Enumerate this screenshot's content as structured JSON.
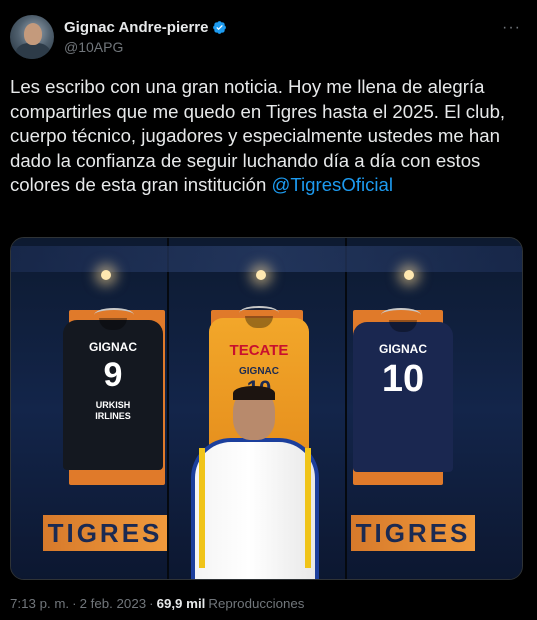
{
  "author": {
    "display_name": "Gignac Andre-pierre",
    "handle": "@10APG",
    "verified": true,
    "avatar_icon": "profile-photo"
  },
  "menu": {
    "more_label": "···"
  },
  "tweet": {
    "text": "Les escribo con una gran noticia. Hoy me llena de alegría compartirles que me quedo en Tigres hasta el 2025. El club, cuerpo técnico, jugadores y especialmente ustedes me han dado la confianza de seguir luchando día a día con estos colores de esta gran institución ",
    "mention": "@TigresOficial"
  },
  "media": {
    "jersey_left": {
      "name": "GIGNAC",
      "number": "9",
      "sponsor": "URKISH IRLINES"
    },
    "jersey_center": {
      "sponsor": "TECATE",
      "name": "GIGNAC",
      "number": "10"
    },
    "jersey_right": {
      "name": "GIGNAC",
      "number": "10"
    },
    "nameplate_left": "TIGRES",
    "nameplate_right": "TIGRES"
  },
  "meta": {
    "time": "7:13 p. m.",
    "separator": "·",
    "date": "2 feb. 2023",
    "views_count": "69,9 mil",
    "views_label": "Reproducciones"
  },
  "colors": {
    "background": "#000000",
    "text": "#e7e9ea",
    "secondary": "#71767b",
    "link": "#1d9bf0",
    "verified": "#1d9bf0"
  }
}
